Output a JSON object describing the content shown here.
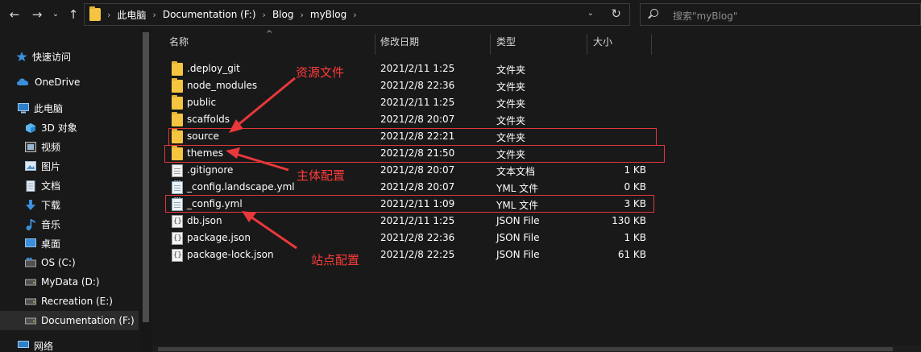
{
  "nav_buttons": {
    "back": "←",
    "forward": "→",
    "recent": "⌄",
    "up": "↑"
  },
  "breadcrumb": [
    "此电脑",
    "Documentation (F:)",
    "Blog",
    "myBlog"
  ],
  "address": {
    "dropdown": "⌄",
    "refresh": "↻"
  },
  "search": {
    "placeholder": "搜索\"myBlog\""
  },
  "sidebar": {
    "items": [
      {
        "label": "快速访问",
        "icon": "star-icon"
      },
      {
        "label": "OneDrive",
        "icon": "cloud-icon"
      },
      {
        "label": "此电脑",
        "icon": "computer-icon"
      },
      {
        "label": "3D 对象",
        "icon": "cube-icon"
      },
      {
        "label": "视频",
        "icon": "video-icon"
      },
      {
        "label": "图片",
        "icon": "picture-icon"
      },
      {
        "label": "文档",
        "icon": "document-icon"
      },
      {
        "label": "下载",
        "icon": "download-icon"
      },
      {
        "label": "音乐",
        "icon": "music-icon"
      },
      {
        "label": "桌面",
        "icon": "desktop-icon"
      },
      {
        "label": "OS (C:)",
        "icon": "windows-drive-icon"
      },
      {
        "label": "MyData (D:)",
        "icon": "drive-icon"
      },
      {
        "label": "Recreation (E:)",
        "icon": "drive-icon"
      },
      {
        "label": "Documentation (F:)",
        "icon": "drive-icon",
        "selected": true
      },
      {
        "label": "网络",
        "icon": "network-icon"
      }
    ]
  },
  "columns": {
    "name": "名称",
    "modified": "修改日期",
    "type": "类型",
    "size": "大小",
    "sort_indicator": "^"
  },
  "files": [
    {
      "name": ".deploy_git",
      "modified": "2021/2/11 1:25",
      "type": "文件夹",
      "size": "",
      "icon": "folder-icon"
    },
    {
      "name": "node_modules",
      "modified": "2021/2/8 22:36",
      "type": "文件夹",
      "size": "",
      "icon": "folder-icon"
    },
    {
      "name": "public",
      "modified": "2021/2/11 1:25",
      "type": "文件夹",
      "size": "",
      "icon": "folder-icon"
    },
    {
      "name": "scaffolds",
      "modified": "2021/2/8 20:07",
      "type": "文件夹",
      "size": "",
      "icon": "folder-icon"
    },
    {
      "name": "source",
      "modified": "2021/2/8 22:21",
      "type": "文件夹",
      "size": "",
      "icon": "folder-icon"
    },
    {
      "name": "themes",
      "modified": "2021/2/8 21:50",
      "type": "文件夹",
      "size": "",
      "icon": "folder-icon"
    },
    {
      "name": ".gitignore",
      "modified": "2021/2/8 20:07",
      "type": "文本文档",
      "size": "1 KB",
      "icon": "text-file-icon"
    },
    {
      "name": "_config.landscape.yml",
      "modified": "2021/2/8 20:07",
      "type": "YML 文件",
      "size": "0 KB",
      "icon": "yml-file-icon"
    },
    {
      "name": "_config.yml",
      "modified": "2021/2/11 1:09",
      "type": "YML 文件",
      "size": "3 KB",
      "icon": "yml-file-icon"
    },
    {
      "name": "db.json",
      "modified": "2021/2/11 1:25",
      "type": "JSON File",
      "size": "130 KB",
      "icon": "json-file-icon"
    },
    {
      "name": "package.json",
      "modified": "2021/2/8 22:36",
      "type": "JSON File",
      "size": "1 KB",
      "icon": "json-file-icon"
    },
    {
      "name": "package-lock.json",
      "modified": "2021/2/8 22:25",
      "type": "JSON File",
      "size": "61 KB",
      "icon": "json-file-icon"
    }
  ],
  "annotations": {
    "source": "资源文件",
    "themes": "主体配置",
    "config": "站点配置",
    "color": "#ff3a3a"
  }
}
